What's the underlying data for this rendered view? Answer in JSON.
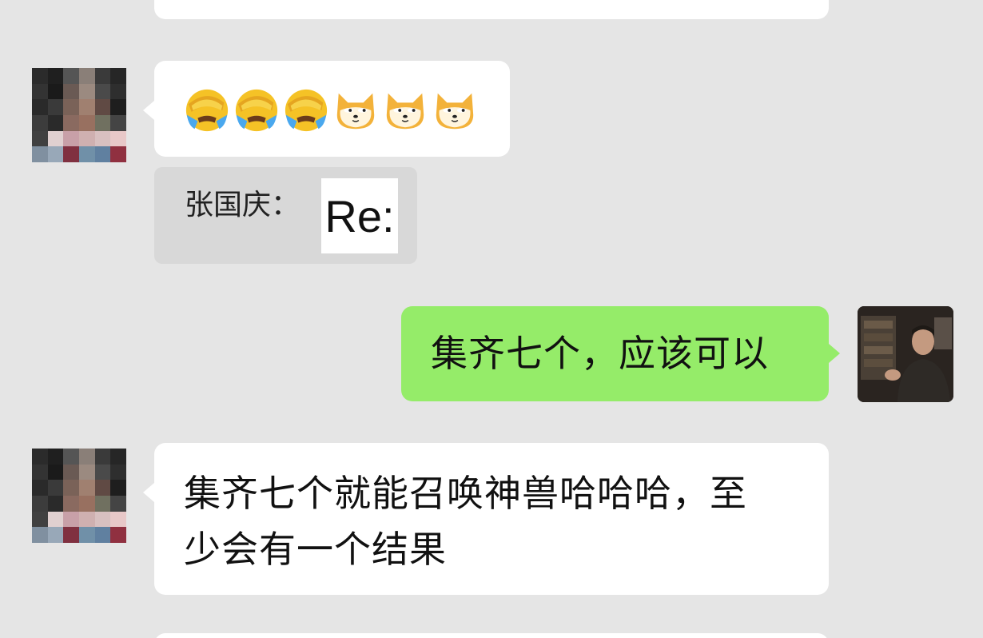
{
  "chat": {
    "messages": [
      {
        "sender": "other",
        "emojis": [
          "facepalm-crying-icon",
          "facepalm-crying-icon",
          "facepalm-crying-icon",
          "doge-icon",
          "doge-icon",
          "doge-icon"
        ]
      },
      {
        "sender": "other-quote",
        "quote_name": "张国庆：",
        "quote_thumb_text": "Re:"
      },
      {
        "sender": "me",
        "text": "集齐七个，应该可以"
      },
      {
        "sender": "other",
        "text_line1": "集齐七个就能召唤神兽哈哈哈，至",
        "text_line2": "少会有一个结果"
      }
    ]
  },
  "colors": {
    "background": "#e5e5e5",
    "bubble_other": "#ffffff",
    "bubble_me": "#95ec69",
    "quote_bg": "#d8d8d8"
  }
}
